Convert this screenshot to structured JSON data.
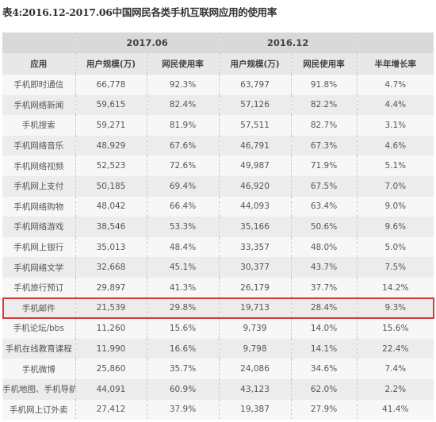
{
  "title": "表4:2016.12-2017.06中国网民各类手机互联网应用的使用率",
  "header": {
    "period_1": "2017.06",
    "period_2": "2016.12",
    "col_app": "应用",
    "col_users_1": "用户规模(万)",
    "col_rate_1": "网民使用率",
    "col_users_2": "用户规模(万)",
    "col_rate_2": "网民使用率",
    "col_growth": "半年增长率"
  },
  "highlight_color": "#d33b3b",
  "highlighted_row": "手机邮件",
  "rows": [
    {
      "app": "手机即时通信",
      "users_2017_06": "66,778",
      "rate_2017_06": "92.3%",
      "users_2016_12": "63,797",
      "rate_2016_12": "91.8%",
      "growth": "4.7%"
    },
    {
      "app": "手机网络新闻",
      "users_2017_06": "59,615",
      "rate_2017_06": "82.4%",
      "users_2016_12": "57,126",
      "rate_2016_12": "82.2%",
      "growth": "4.4%"
    },
    {
      "app": "手机搜索",
      "users_2017_06": "59,271",
      "rate_2017_06": "81.9%",
      "users_2016_12": "57,511",
      "rate_2016_12": "82.7%",
      "growth": "3.1%"
    },
    {
      "app": "手机网络音乐",
      "users_2017_06": "48,929",
      "rate_2017_06": "67.6%",
      "users_2016_12": "46,791",
      "rate_2016_12": "67.3%",
      "growth": "4.6%"
    },
    {
      "app": "手机网络视频",
      "users_2017_06": "52,523",
      "rate_2017_06": "72.6%",
      "users_2016_12": "49,987",
      "rate_2016_12": "71.9%",
      "growth": "5.1%"
    },
    {
      "app": "手机网上支付",
      "users_2017_06": "50,185",
      "rate_2017_06": "69.4%",
      "users_2016_12": "46,920",
      "rate_2016_12": "67.5%",
      "growth": "7.0%"
    },
    {
      "app": "手机网络购物",
      "users_2017_06": "48,042",
      "rate_2017_06": "66.4%",
      "users_2016_12": "44,093",
      "rate_2016_12": "63.4%",
      "growth": "9.0%"
    },
    {
      "app": "手机网络游戏",
      "users_2017_06": "38,546",
      "rate_2017_06": "53.3%",
      "users_2016_12": "35,166",
      "rate_2016_12": "50.6%",
      "growth": "9.6%"
    },
    {
      "app": "手机网上银行",
      "users_2017_06": "35,013",
      "rate_2017_06": "48.4%",
      "users_2016_12": "33,357",
      "rate_2016_12": "48.0%",
      "growth": "5.0%"
    },
    {
      "app": "手机网络文学",
      "users_2017_06": "32,668",
      "rate_2017_06": "45.1%",
      "users_2016_12": "30,377",
      "rate_2016_12": "43.7%",
      "growth": "7.5%"
    },
    {
      "app": "手机旅行预订",
      "users_2017_06": "29,897",
      "rate_2017_06": "41.3%",
      "users_2016_12": "26,179",
      "rate_2016_12": "37.7%",
      "growth": "14.2%"
    },
    {
      "app": "手机邮件",
      "users_2017_06": "21,539",
      "rate_2017_06": "29.8%",
      "users_2016_12": "19,713",
      "rate_2016_12": "28.4%",
      "growth": "9.3%"
    },
    {
      "app": "手机论坛/bbs",
      "users_2017_06": "11,260",
      "rate_2017_06": "15.6%",
      "users_2016_12": "9,739",
      "rate_2016_12": "14.0%",
      "growth": "15.6%"
    },
    {
      "app": "手机在线教育课程",
      "users_2017_06": "11,990",
      "rate_2017_06": "16.6%",
      "users_2016_12": "9,798",
      "rate_2016_12": "14.1%",
      "growth": "22.4%"
    },
    {
      "app": "手机微博",
      "users_2017_06": "25,860",
      "rate_2017_06": "35.7%",
      "users_2016_12": "24,086",
      "rate_2016_12": "34.6%",
      "growth": "7.4%"
    },
    {
      "app": "手机地图、手机导航",
      "users_2017_06": "44,091",
      "rate_2017_06": "60.9%",
      "users_2016_12": "43,123",
      "rate_2016_12": "62.0%",
      "growth": "2.2%"
    },
    {
      "app": "手机网上订外卖",
      "users_2017_06": "27,412",
      "rate_2017_06": "37.9%",
      "users_2016_12": "19,387",
      "rate_2016_12": "27.9%",
      "growth": "41.4%"
    }
  ]
}
